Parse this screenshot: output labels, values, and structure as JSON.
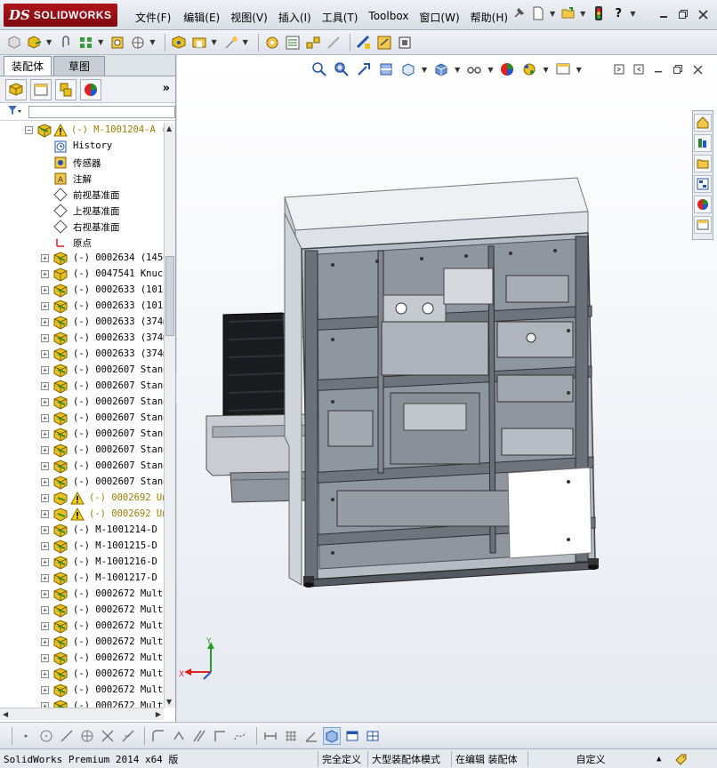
{
  "app": {
    "logo_ds": "DS",
    "logo_text": "SOLIDWORKS"
  },
  "menu": [
    "文件(F)",
    "编辑(E)",
    "视图(V)",
    "插入(I)",
    "工具(T)",
    "Toolbox",
    "窗口(W)",
    "帮助(H)"
  ],
  "panel_tabs": {
    "assembly": "装配体",
    "sketch": "草图"
  },
  "tree": {
    "root": "(-) M-1001204-A (",
    "items": [
      {
        "label": "History",
        "icon": "history-icon",
        "expand": false
      },
      {
        "label": "传感器",
        "icon": "sensor-icon",
        "expand": false
      },
      {
        "label": "注解",
        "icon": "annotation-icon",
        "expand": false
      },
      {
        "label": "前视基准面",
        "icon": "plane-icon",
        "expand": false
      },
      {
        "label": "上视基准面",
        "icon": "plane-icon",
        "expand": false
      },
      {
        "label": "右视基准面",
        "icon": "plane-icon",
        "expand": false
      },
      {
        "label": "原点",
        "icon": "origin-icon",
        "expand": false
      },
      {
        "label": "(-) 0002634 (1450",
        "icon": "subassembly-icon",
        "expand": true
      },
      {
        "label": "(-) 0047541 Knuck",
        "icon": "part-icon",
        "expand": true
      },
      {
        "label": "(-) 0002633 (1012",
        "icon": "subassembly-icon",
        "expand": true
      },
      {
        "label": "(-) 0002633 (1012",
        "icon": "subassembly-icon",
        "expand": true
      },
      {
        "label": "(-) 0002633 (374m",
        "icon": "subassembly-icon",
        "expand": true
      },
      {
        "label": "(-) 0002633 (374m",
        "icon": "subassembly-icon",
        "expand": true
      },
      {
        "label": "(-) 0002633 (374m",
        "icon": "subassembly-icon",
        "expand": true
      },
      {
        "label": "(-) 0002607 Stand",
        "icon": "subassembly-icon",
        "expand": true
      },
      {
        "label": "(-) 0002607 Stand",
        "icon": "subassembly-icon",
        "expand": true
      },
      {
        "label": "(-) 0002607 Stand",
        "icon": "subassembly-icon",
        "expand": true
      },
      {
        "label": "(-) 0002607 Stand",
        "icon": "subassembly-icon",
        "expand": true
      },
      {
        "label": "(-) 0002607 Stand",
        "icon": "subassembly-icon",
        "expand": true
      },
      {
        "label": "(-) 0002607 Stand",
        "icon": "subassembly-icon",
        "expand": true
      },
      {
        "label": "(-) 0002607 Stand",
        "icon": "subassembly-icon",
        "expand": true
      },
      {
        "label": "(-) 0002607 Stand",
        "icon": "subassembly-icon",
        "expand": true
      },
      {
        "label": "(-) 0002692 Un",
        "icon": "warning-subassembly-icon",
        "expand": true,
        "warn": true
      },
      {
        "label": "(-) 0002692 Un",
        "icon": "warning-subassembly-icon",
        "expand": true,
        "warn": true
      },
      {
        "label": "(-) M-1001214-D (",
        "icon": "subassembly-icon",
        "expand": true
      },
      {
        "label": "(-) M-1001215-D (",
        "icon": "subassembly-icon",
        "expand": true
      },
      {
        "label": "(-) M-1001216-D (",
        "icon": "subassembly-icon",
        "expand": true
      },
      {
        "label": "(-) M-1001217-D (",
        "icon": "subassembly-icon",
        "expand": true
      },
      {
        "label": "(-) 0002672 Multi",
        "icon": "subassembly-icon",
        "expand": true
      },
      {
        "label": "(-) 0002672 Multi",
        "icon": "subassembly-icon",
        "expand": true
      },
      {
        "label": "(-) 0002672 Multi",
        "icon": "subassembly-icon",
        "expand": true
      },
      {
        "label": "(-) 0002672 Multi",
        "icon": "subassembly-icon",
        "expand": true
      },
      {
        "label": "(-) 0002672 Multi",
        "icon": "subassembly-icon",
        "expand": true
      },
      {
        "label": "(-) 0002672 Multi",
        "icon": "subassembly-icon",
        "expand": true
      },
      {
        "label": "(-) 0002672 Multi",
        "icon": "subassembly-icon",
        "expand": true
      },
      {
        "label": "(-) 0002672 Multi",
        "icon": "subassembly-icon",
        "expand": true
      }
    ]
  },
  "triad": {
    "x": "X",
    "y": "Y"
  },
  "status": {
    "product": "SolidWorks Premium 2014 x64 版",
    "defined": "完全定义",
    "mode": "大型装配体模式",
    "editing": "在编辑 装配体",
    "custom": "自定义"
  },
  "colors": {
    "accent_red": "#b0131b",
    "tree_part_yellow": "#e8c020",
    "warning_text": "#9a8000",
    "machine_frame": "#6b7079"
  }
}
